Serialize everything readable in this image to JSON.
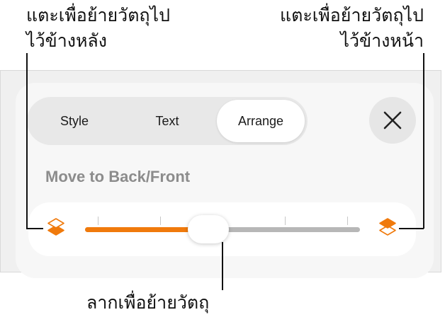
{
  "callouts": {
    "back": [
      "แตะเพื่อย้ายวัตถุไป",
      "ไว้ข้างหลัง"
    ],
    "front": [
      "แตะเพื่อย้ายวัตถุไป",
      "ไว้ข้างหน้า"
    ],
    "drag": "ลากเพื่อย้ายวัตถุ"
  },
  "tabs": [
    {
      "label": "Style",
      "selected": false
    },
    {
      "label": "Text",
      "selected": false
    },
    {
      "label": "Arrange",
      "selected": true
    }
  ],
  "close": {
    "icon": "close-icon"
  },
  "section": {
    "title": "Move to Back/Front"
  },
  "slider": {
    "value_fraction": 0.5,
    "tick_count": 5,
    "back_icon": "layers-back-icon",
    "front_icon": "layers-front-icon"
  },
  "colors": {
    "accent": "#f07a0c",
    "track": "#b7b7b7",
    "panel": "#f7f7f7"
  }
}
